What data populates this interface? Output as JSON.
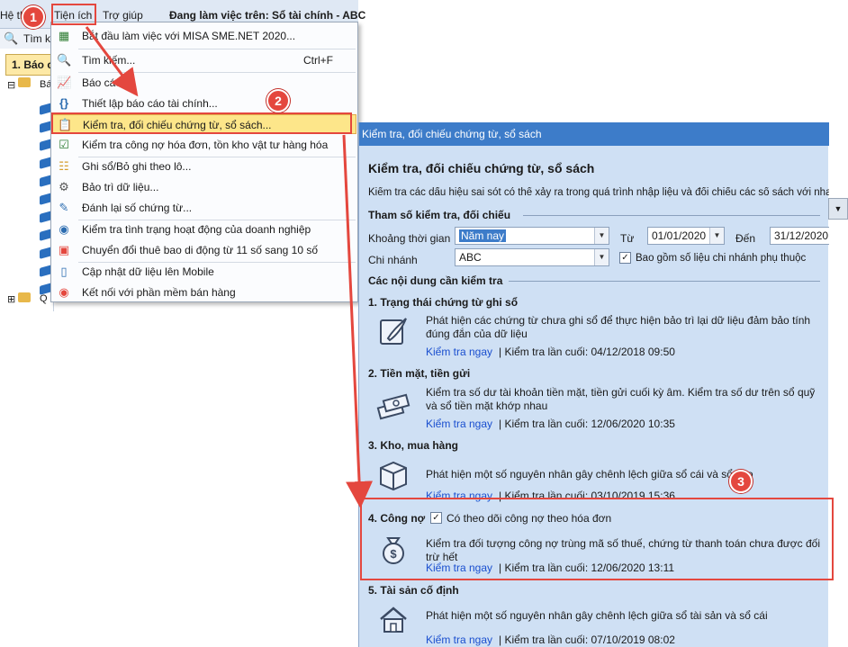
{
  "menubar": {
    "he_label": "Hệ th",
    "tienich_label": "Tiện ích",
    "trogiup_label": "Trợ giúp",
    "working_title": "Đang làm việc trên: Sổ tài chính - ABC"
  },
  "toolbar": {
    "search_label": "Tìm k"
  },
  "left_panel": {
    "tab_label": "1. Báo c",
    "tree_root_label": "Bá",
    "tree_bottom_label": "Q"
  },
  "menu": {
    "items": [
      {
        "icon": "misa-start-icon",
        "label": "Bắt đầu làm việc với MISA SME.NET 2020...",
        "shortcut": ""
      },
      {
        "icon": "search-icon",
        "label": "Tìm kiếm...",
        "shortcut": "Ctrl+F"
      },
      {
        "icon": "report-icon",
        "label": "Báo cáo",
        "shortcut": ""
      },
      {
        "icon": "formula-icon",
        "label": "Thiết lập báo cáo tài chính...",
        "shortcut": ""
      },
      {
        "icon": "check-document-icon",
        "label": "Kiểm tra, đối chiếu chứng từ, sổ sách...",
        "shortcut": ""
      },
      {
        "icon": "checkmark-icon",
        "label": "Kiểm tra công nợ hóa đơn, tồn kho vật tư hàng hóa",
        "shortcut": ""
      },
      {
        "icon": "batch-posting-icon",
        "label": "Ghi sổ/Bỏ ghi theo lô...",
        "shortcut": ""
      },
      {
        "icon": "gear-icon",
        "label": "Bảo trì dữ liệu...",
        "shortcut": ""
      },
      {
        "icon": "renumber-icon",
        "label": "Đánh lại số chứng từ...",
        "shortcut": ""
      },
      {
        "icon": "business-status-icon",
        "label": "Kiểm tra tình trạng hoạt động của doanh nghiệp",
        "shortcut": ""
      },
      {
        "icon": "phone-convert-icon",
        "label": "Chuyển đổi thuê bao di động từ 11 số sang 10 số",
        "shortcut": ""
      },
      {
        "icon": "mobile-icon",
        "label": "Cập nhật dữ liệu lên Mobile",
        "shortcut": ""
      },
      {
        "icon": "sales-connect-icon",
        "label": "Kết nối với phần mềm bán hàng",
        "shortcut": ""
      }
    ]
  },
  "dialog": {
    "window_title": "Kiểm tra, đối chiếu chứng từ, sổ sách",
    "heading": "Kiểm tra, đối chiếu chứng từ, sổ sách",
    "description": "Kiểm tra các dấu hiệu sai sót có thể xảy ra trong quá trình nhập liệu và đối chiếu các sổ sách với nhau",
    "params_head": "Tham số kiểm tra, đối chiếu",
    "period_label": "Khoảng thời gian",
    "period_value": "Năm nay",
    "from_label": "Từ",
    "from_value": "01/01/2020",
    "to_label": "Đến",
    "to_value": "31/12/2020",
    "branch_label": "Chi nhánh",
    "branch_value": "ABC",
    "include_branch_label": "Bao gồm số liệu chi nhánh phụ thuộc",
    "contents_head": "Các nội dung cần kiểm tra",
    "link_label": "Kiểm tra ngay",
    "items": [
      {
        "title": "1. Trạng thái chứng từ ghi sổ",
        "desc": "Phát hiện các chứng từ chưa ghi sổ để thực hiện bảo trì lại dữ liệu đảm bảo tính đúng đắn của dữ liệu",
        "last": "| Kiểm tra lần cuối: 04/12/2018 09:50"
      },
      {
        "title": "2. Tiền mặt, tiền gửi",
        "desc": "Kiểm tra số dư tài khoản tiền mặt, tiền gửi cuối kỳ âm. Kiểm tra số dư trên sổ quỹ và sổ tiền mặt khớp nhau",
        "last": "| Kiểm tra lần cuối: 12/06/2020 10:35"
      },
      {
        "title": "3. Kho, mua hàng",
        "desc": "Phát hiện một số nguyên nhân gây chênh lệch giữa sổ cái và sổ kho",
        "last": "| Kiểm tra lần cuối: 03/10/2019 15:36"
      },
      {
        "title": "4. Công nợ",
        "desc": "Kiểm tra đối tượng công nợ trùng mã số thuế, chứng từ thanh toán chưa được đối trừ hết",
        "last": "| Kiểm tra lần cuối: 12/06/2020 13:11"
      },
      {
        "title": "5. Tài sản cố định",
        "desc": "Phát hiện một số nguyên nhân gây chênh lệch giữa sổ tài sản và sổ cái",
        "last": "| Kiểm tra lần cuối: 07/10/2019 08:02"
      }
    ],
    "debt_invoice_label": "Có theo dõi công nợ theo hóa đơn"
  },
  "annotations": {
    "step1": "1",
    "step2": "2",
    "step3": "3"
  },
  "colors": {
    "annotation_red": "#e4473e",
    "menu_highlight": "#fde68a",
    "dialog_bg": "#cfe0f4",
    "titlebar": "#3d7cc9",
    "link": "#1a4fcf"
  }
}
